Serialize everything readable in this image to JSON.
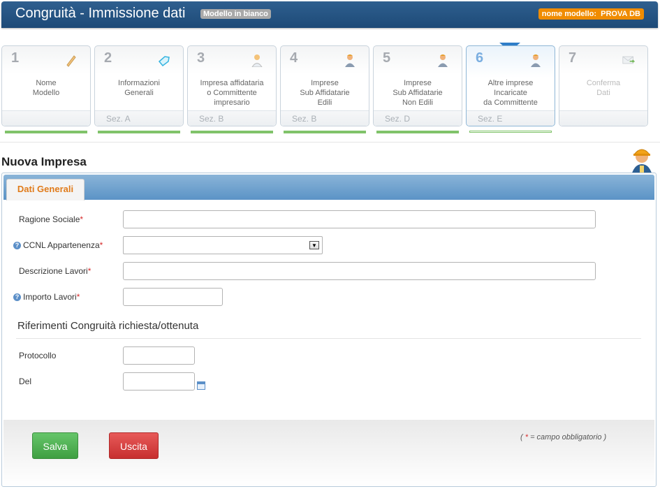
{
  "header": {
    "title": "Congruità - Immissione dati",
    "badge": "Modello in bianco",
    "model_label": "nome modello:",
    "model_value": "PROVA DB"
  },
  "steps": [
    {
      "num": "1",
      "label": "Nome\nModello",
      "sez": "",
      "icon": "pencil-icon"
    },
    {
      "num": "2",
      "label": "Informazioni\nGenerali",
      "sez": "Sez. A",
      "icon": "tag-icon"
    },
    {
      "num": "3",
      "label": "Impresa affidataria\no Committente\nimpresario",
      "sez": "Sez. B",
      "icon": "person-icon"
    },
    {
      "num": "4",
      "label": "Imprese\nSub Affidatarie\nEdili",
      "sez": "Sez. B",
      "icon": "worker-icon"
    },
    {
      "num": "5",
      "label": "Imprese\nSub Affidatarie\nNon Edili",
      "sez": "Sez. D",
      "icon": "worker-icon"
    },
    {
      "num": "6",
      "label": "Altre imprese\nIncaricate\nda Committente",
      "sez": "Sez. E",
      "icon": "worker-icon"
    },
    {
      "num": "7",
      "label": "Conferma\nDati",
      "sez": "",
      "icon": "envelope-icon"
    }
  ],
  "section_title": "Nuova Impresa",
  "tab": "Dati Generali",
  "form": {
    "ragione_sociale": "Ragione Sociale",
    "ccnl": "CCNL Appartenenza",
    "descrizione": "Descrizione Lavori",
    "importo": "Importo Lavori",
    "required_mark": "*",
    "ccnl_value": "",
    "riferimenti_title": "Riferimenti Congruità richiesta/ottenuta",
    "protocollo": "Protocollo",
    "del": "Del"
  },
  "footer": {
    "save": "Salva",
    "exit": "Uscita",
    "note_open": "(",
    "note_star": "*",
    "note_text": "= campo obbligatorio )"
  }
}
